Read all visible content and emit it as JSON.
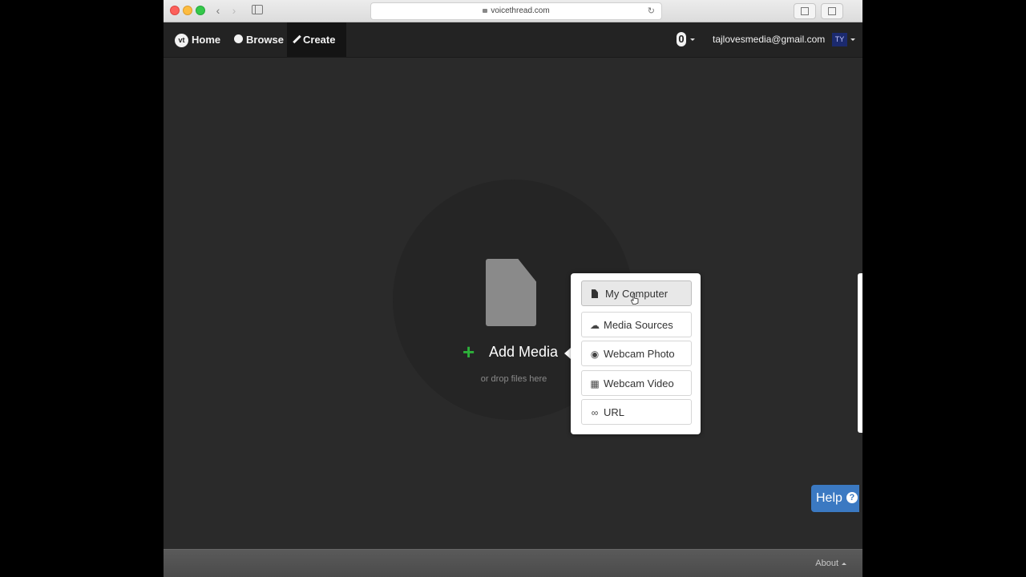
{
  "browser": {
    "url": "voicethread.com",
    "back_icon": "chevron-left-icon",
    "forward_icon": "chevron-right-icon"
  },
  "nav": {
    "logo_text": "vt",
    "home_label": "Home",
    "browse_label": "Browse",
    "create_label": "Create",
    "notification_count": "0",
    "user_email": "tajlovesmedia@gmail.com",
    "avatar_initials": "TY"
  },
  "main": {
    "add_media_label": "Add Media",
    "drop_hint": "or drop files here"
  },
  "menu": {
    "items": [
      {
        "label": "My Computer",
        "icon": "file-icon"
      },
      {
        "label": "Media Sources",
        "icon": "cloud-upload-icon"
      },
      {
        "label": "Webcam Photo",
        "icon": "camera-icon"
      },
      {
        "label": "Webcam Video",
        "icon": "film-icon"
      },
      {
        "label": "URL",
        "icon": "link-icon"
      }
    ]
  },
  "help": {
    "label": "Help"
  },
  "footer": {
    "about_label": "About"
  },
  "colors": {
    "accent_green": "#2db13a",
    "help_blue": "#3b79c2",
    "nav_bg": "#232323"
  }
}
